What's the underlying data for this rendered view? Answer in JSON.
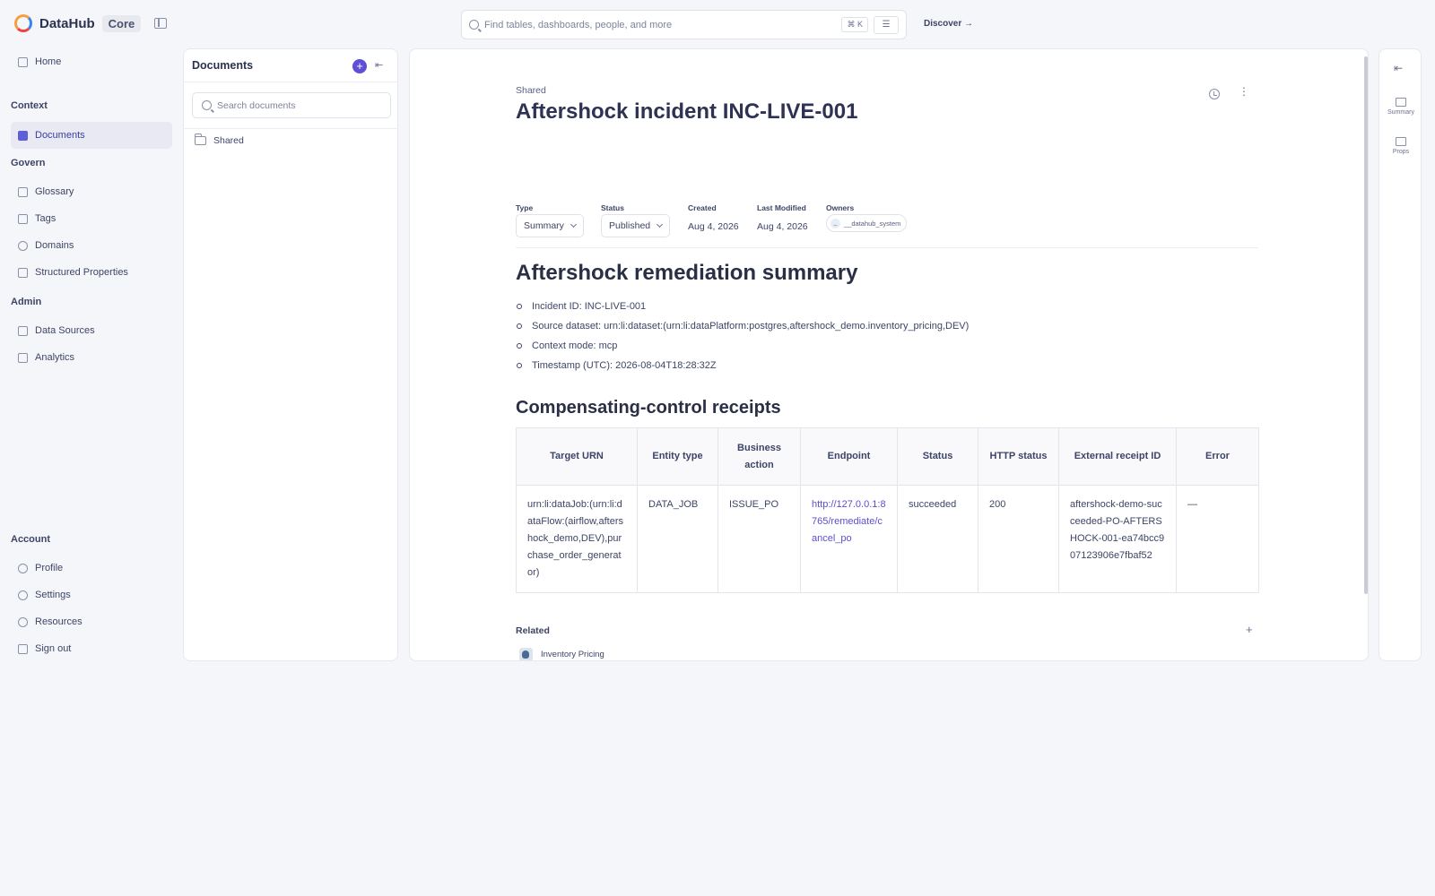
{
  "app": {
    "name": "DataHub",
    "edition": "Core"
  },
  "search": {
    "placeholder": "Find tables, dashboards, people, and more",
    "shortcut": "⌘ K",
    "discover_label": "Discover →"
  },
  "nav": {
    "home": "Home",
    "context_section": "Context",
    "documents": "Documents",
    "govern_section": "Govern",
    "glossary": "Glossary",
    "tags": "Tags",
    "domains": "Domains",
    "structured_properties": "Structured Properties",
    "admin_section": "Admin",
    "data_sources": "Data Sources",
    "analytics": "Analytics",
    "account_section": "Account",
    "profile": "Profile",
    "settings": "Settings",
    "resources": "Resources",
    "sign_out": "Sign out"
  },
  "documents_panel": {
    "title": "Documents",
    "add": "+",
    "collapse": "⇤",
    "search_placeholder": "Search documents",
    "folder": "Shared"
  },
  "document": {
    "breadcrumb": "Shared",
    "title": "Aftershock incident INC-LIVE-001",
    "meta": {
      "type_label": "Type",
      "type_value": "Summary",
      "status_label": "Status",
      "status_value": "Published",
      "created_label": "Created",
      "created_value": "Aug 4, 2026",
      "modified_label": "Last Modified",
      "modified_value": "Aug 4, 2026",
      "owners_label": "Owners",
      "owner_avatar": "_",
      "owner_name": "__datahub_system"
    },
    "heading1": "Aftershock remediation summary",
    "bullets": [
      "Incident ID: INC-LIVE-001",
      "Source dataset: urn:li:dataset:(urn:li:dataPlatform:postgres,aftershock_demo.inventory_pricing,DEV)",
      "Context mode: mcp",
      "Timestamp (UTC): 2026-08-04T18:28:32Z"
    ],
    "heading2": "Compensating-control receipts",
    "table": {
      "headers": [
        "Target URN",
        "Entity type",
        "Business action",
        "Endpoint",
        "Status",
        "HTTP status",
        "External receipt ID",
        "Error"
      ],
      "row": [
        "urn:li:dataJob:(urn:li:dataFlow:(airflow,aftershock_demo,DEV),purchase_order_generator)",
        "DATA_JOB",
        "ISSUE_PO",
        "http://127.0.0.1:8765/remediate/cancel_po",
        "succeeded",
        "200",
        "aftershock-demo-succeeded-PO-AFTERSHOCK-001-ea74bcc907123906e7fbaf52",
        "—"
      ]
    },
    "related_label": "Related",
    "related_add": "+",
    "related_item": "Inventory Pricing"
  },
  "right_rail": {
    "collapse": "⇤",
    "summary": "Summary",
    "props": "Props"
  }
}
